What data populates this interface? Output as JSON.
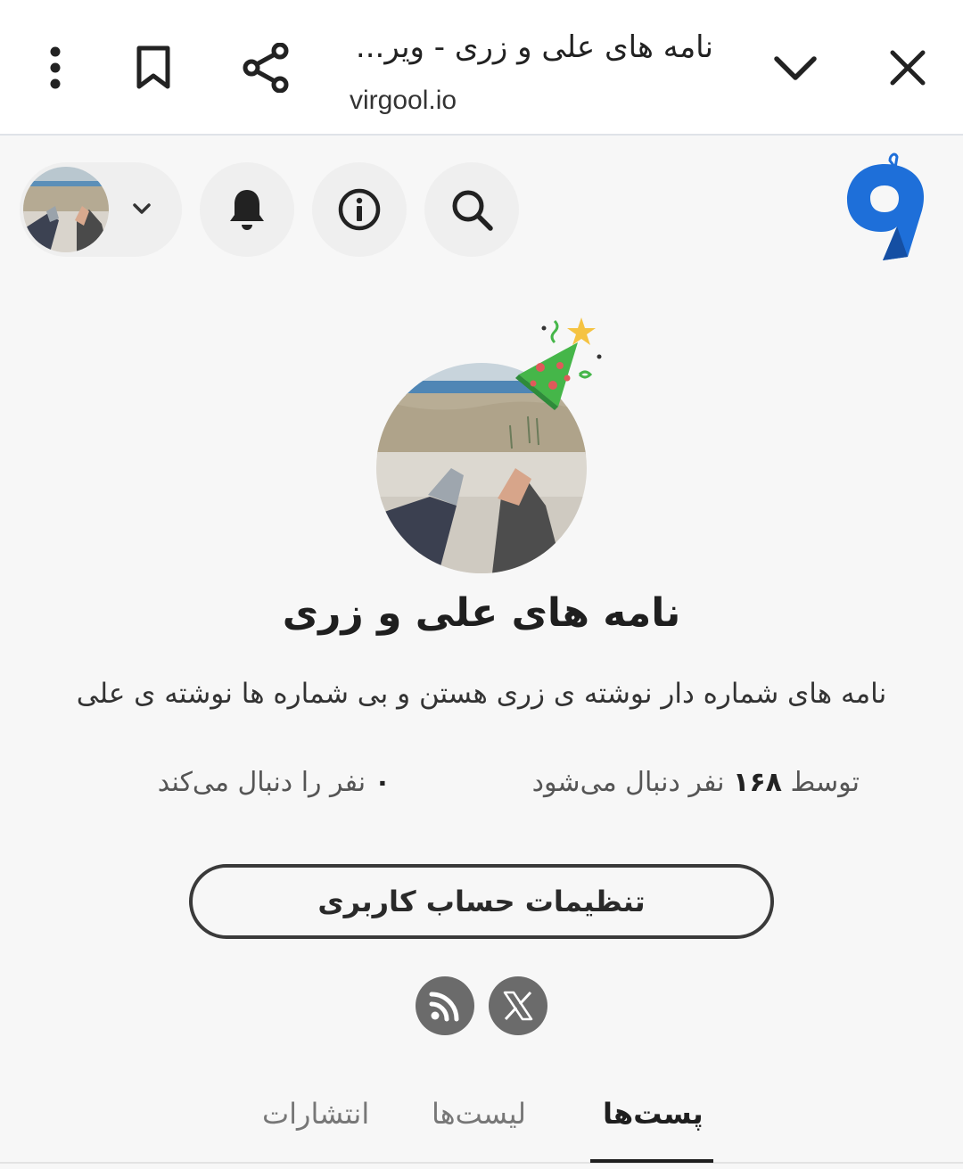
{
  "browser": {
    "page_title": "نامه های علی و زری - ویر...",
    "url": "virgool.io"
  },
  "header": {
    "logo_icon": "virgool-logo",
    "search_icon": "search-icon",
    "info_icon": "info-icon",
    "notifications_icon": "bell-icon",
    "account_chevron": "chevron-down-icon"
  },
  "profile": {
    "name": "نامه های علی و زری",
    "bio": "نامه های شماره دار نوشته ی زری هستن و بی شماره ها نوشته ی علی",
    "followers_prefix": "توسط",
    "followers_count": "۱۶۸",
    "followers_suffix": "نفر دنبال می‌شود",
    "following_count": "۰",
    "following_suffix": "نفر را دنبال می‌کند",
    "settings_label": "تنظیمات حساب کاربری"
  },
  "social": {
    "rss_icon": "rss-icon",
    "x_icon": "x-twitter-icon"
  },
  "tabs": [
    {
      "label": "پست‌ها",
      "active": true
    },
    {
      "label": "لیست‌ها",
      "active": false
    },
    {
      "label": "انتشارات",
      "active": false
    }
  ],
  "colors": {
    "brand_blue": "#1e6fd9",
    "active_tab": "#1f1f1f",
    "background": "#f7f7f7"
  }
}
